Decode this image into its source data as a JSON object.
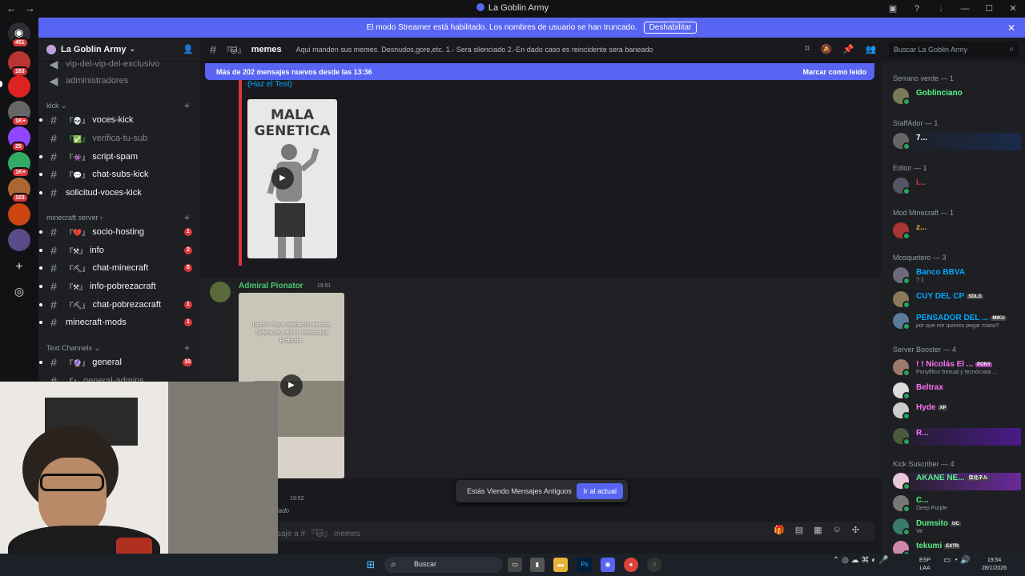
{
  "window": {
    "title": "La Goblin Army"
  },
  "banner": {
    "text": "El modo Streamer está habilitado. Los nombres de usuario se han truncado.",
    "button": "Deshabilitar"
  },
  "servers": [
    {
      "badge": "451"
    },
    {
      "badge": "183"
    },
    {
      "badge": ""
    },
    {
      "badge": "1K+"
    },
    {
      "badge": "25"
    },
    {
      "badge": "1K+"
    },
    {
      "badge": "103"
    },
    {
      "badge": ""
    },
    {
      "badge": ""
    }
  ],
  "guild": {
    "name": "La Goblin Army"
  },
  "channels_top": [
    {
      "name": "vip-del-vip-del-exclusivo"
    },
    {
      "name": "administradores"
    }
  ],
  "categories": {
    "kick": "kick",
    "minecraft": "minecraft server",
    "text": "Text Channels"
  },
  "kick_channels": [
    {
      "name": "voces-kick",
      "badge": ""
    },
    {
      "name": "verifica-tu-sub",
      "badge": ""
    },
    {
      "name": "script-spam",
      "badge": ""
    },
    {
      "name": "chat-subs-kick",
      "badge": ""
    },
    {
      "name": "solicitud-voces-kick",
      "badge": ""
    }
  ],
  "mc_channels": [
    {
      "name": "socio-hosting",
      "badge": "1"
    },
    {
      "name": "info",
      "badge": "2"
    },
    {
      "name": "chat-minecraft",
      "badge": "5"
    },
    {
      "name": "info-pobrezacraft",
      "badge": ""
    },
    {
      "name": "chat-pobrezacraft",
      "badge": "1"
    },
    {
      "name": "minecraft-mods",
      "badge": "1"
    }
  ],
  "text_channels": [
    {
      "name": "general",
      "badge": "10"
    },
    {
      "name": "general-admins",
      "badge": ""
    }
  ],
  "header": {
    "channel": "memes",
    "topic": "Aqui manden sus memes. Desnudos,gore,etc. 1.- Sera silenciado 2.-En dado caso es reincidente sera baneado"
  },
  "search": {
    "placeholder": "Buscar La Goblin Army"
  },
  "newbar": {
    "text": "Más de 202 mensajes nuevos desde las 13:36",
    "mark": "Marcar como leído"
  },
  "embed": {
    "link": "(Haz el Test)",
    "thumb_title": "MALA\nGENETICA"
  },
  "message": {
    "author": "Admiral Pionator",
    "time": "19:51",
    "caption": "Doctor: hace operación exitosa\nTarjeta de crédito: rechazada\nEl doctor:",
    "next_time": "19:52",
    "next_snip": "iado"
  },
  "oldbar": {
    "text": "Estás Viendo Mensajes Antiguos",
    "button": "Ir al actual"
  },
  "composer": {
    "placeholder": "saje a # 『🐱』 memes"
  },
  "member_groups": [
    {
      "title": "Serrano verde — 1",
      "members": [
        {
          "name": "Goblinciano",
          "status": "",
          "color": "#57f287"
        }
      ]
    },
    {
      "title": "StaffAdor — 1",
      "members": [
        {
          "name": "7...",
          "status": "",
          "color": "#ffffff"
        }
      ]
    },
    {
      "title": "Editor — 1",
      "members": [
        {
          "name": "i...",
          "status": "",
          "color": "#f23f43"
        }
      ]
    },
    {
      "title": "Mod Minecraft — 1",
      "members": [
        {
          "name": "z...",
          "status": "",
          "color": "#f0b232"
        }
      ]
    },
    {
      "title": "Mosquetero — 3",
      "members": [
        {
          "name": "Banco BBVA",
          "status": "? 1",
          "color": "#00a8fc"
        },
        {
          "name": "CUY DEL CP",
          "status": "",
          "color": "#00a8fc",
          "tag": "SDLG"
        },
        {
          "name": "PENSADOR DEL ...",
          "status": "por que me quieres pegar mano?",
          "color": "#00a8fc",
          "tag": "MIKU"
        }
      ]
    },
    {
      "title": "Server Booster — 4",
      "members": [
        {
          "name": "! ! Nicolás El ...",
          "status": "Ponyfilico Sexual y tecnócrata ...",
          "color": "#ff73fa",
          "tag": "PONY"
        },
        {
          "name": "Beltrax",
          "status": "",
          "color": "#ff73fa"
        },
        {
          "name": "Hyde",
          "status": "",
          "color": "#ff73fa",
          "tag": "XP"
        },
        {
          "name": "R...",
          "status": "",
          "color": "#ff73fa"
        }
      ]
    },
    {
      "title": "Kick Suscriber — 4",
      "members": [
        {
          "name": "AKANE NE...",
          "status": "",
          "color": "#57f287",
          "tag": "亞北ネル"
        },
        {
          "name": "C...",
          "status": "Deep Purple",
          "color": "#57f287"
        },
        {
          "name": "Dumsito",
          "status": "Ve",
          "color": "#57f287",
          "tag": "UC"
        },
        {
          "name": "tekumi",
          "status": "",
          "color": "#57f287",
          "tag": "EXTR"
        }
      ]
    }
  ],
  "taskbar": {
    "search": "Buscar",
    "lang": "ESP\nLAA",
    "time": "19:54",
    "date": "28/1/2026"
  }
}
